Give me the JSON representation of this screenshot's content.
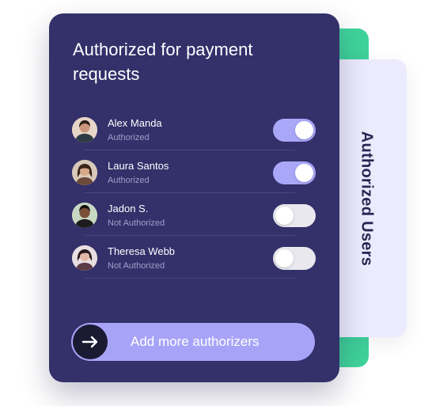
{
  "side_tab": {
    "label": "Authorized Users"
  },
  "card": {
    "title": "Authorized for payment requests",
    "users": [
      {
        "name": "Alex Manda",
        "status": "Authorized",
        "enabled": true
      },
      {
        "name": "Laura Santos",
        "status": "Authorized",
        "enabled": true
      },
      {
        "name": "Jadon S.",
        "status": "Not Authorized",
        "enabled": false
      },
      {
        "name": "Theresa Webb",
        "status": "Not Authorized",
        "enabled": false
      }
    ],
    "add_button": {
      "label": "Add more authorizers",
      "icon": "arrow-right-icon"
    }
  },
  "colors": {
    "card_background": "#33306a",
    "accent": "#a9a7f8",
    "green_tab": "#3fd39a",
    "side_tab": "#ecebfd",
    "toggle_off": "#e8e8ee"
  }
}
